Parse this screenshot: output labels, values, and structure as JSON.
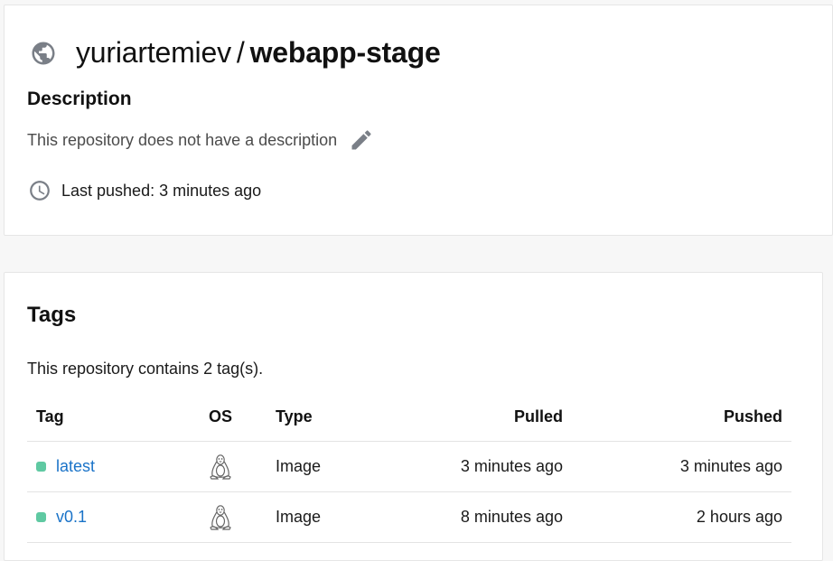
{
  "repo": {
    "owner": "yuriartemiev",
    "separator": "/",
    "name": "webapp-stage",
    "description_heading": "Description",
    "description_text": "This repository does not have a description",
    "last_pushed": "Last pushed: 3 minutes ago"
  },
  "tags_section": {
    "heading": "Tags",
    "count_text": "This repository contains 2 tag(s).",
    "columns": {
      "tag": "Tag",
      "os": "OS",
      "type": "Type",
      "pulled": "Pulled",
      "pushed": "Pushed"
    },
    "rows": [
      {
        "tag": "latest",
        "os_icon": "linux-icon",
        "type": "Image",
        "pulled": "3 minutes ago",
        "pushed": "3 minutes ago",
        "status_color": "#5fc9a2"
      },
      {
        "tag": "v0.1",
        "os_icon": "linux-icon",
        "type": "Image",
        "pulled": "8 minutes ago",
        "pushed": "2 hours ago",
        "status_color": "#5fc9a2"
      }
    ]
  },
  "icons": {
    "visibility": "globe-icon",
    "edit": "pencil-icon",
    "time": "clock-icon"
  },
  "colors": {
    "link": "#1a73c8",
    "status": "#5fc9a2",
    "icon_gray": "#7a7f87"
  }
}
